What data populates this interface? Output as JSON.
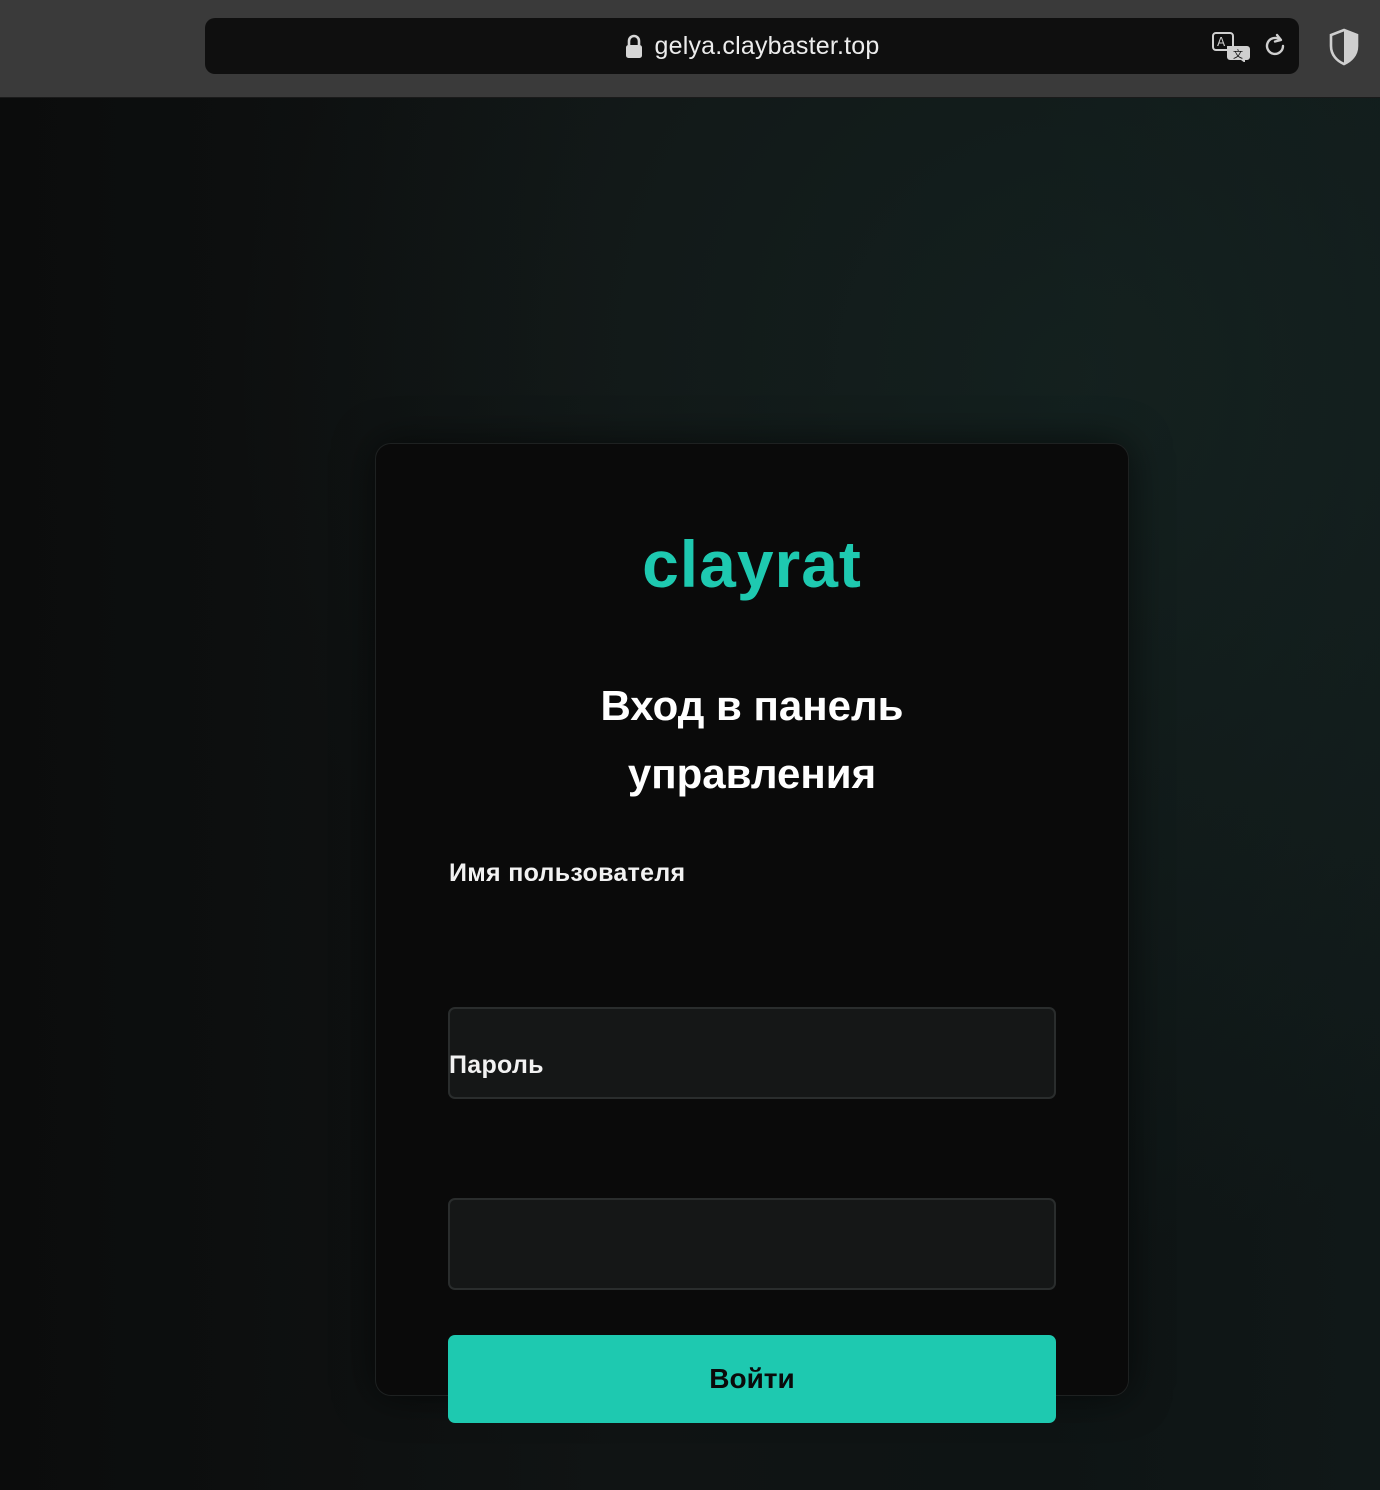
{
  "browser": {
    "url": "gelya.claybaster.top",
    "icons": {
      "lock": "lock-icon",
      "translate": "translate-icon",
      "reload": "reload-icon",
      "privacy": "shield-icon"
    }
  },
  "login": {
    "brand": "clayrat",
    "heading_line1": "Вход в панель",
    "heading_line2": "управления",
    "username_label": "Имя пользователя",
    "username_value": "",
    "password_label": "Пароль",
    "password_value": "",
    "submit_label": "Войти"
  },
  "colors": {
    "accent": "#1ec9b0",
    "card_background": "#0a0a0a",
    "input_background": "#151717"
  }
}
